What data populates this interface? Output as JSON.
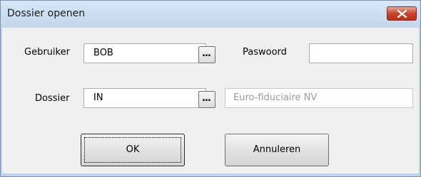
{
  "window": {
    "title": "Dossier openen"
  },
  "form": {
    "user_label": "Gebruiker",
    "user_value": "BOB",
    "password_label": "Paswoord",
    "password_value": "",
    "dossier_label": "Dossier",
    "dossier_value": "IN",
    "dossier_name": "Euro-fiduciaire NV",
    "browse_label": "..."
  },
  "buttons": {
    "ok_label": "OK",
    "cancel_label": "Annuleren"
  },
  "icons": {
    "close": "close-icon"
  },
  "colors": {
    "close_button": "#c6452f",
    "frame": "#bfd3ea",
    "client": "#f0f0f0"
  }
}
